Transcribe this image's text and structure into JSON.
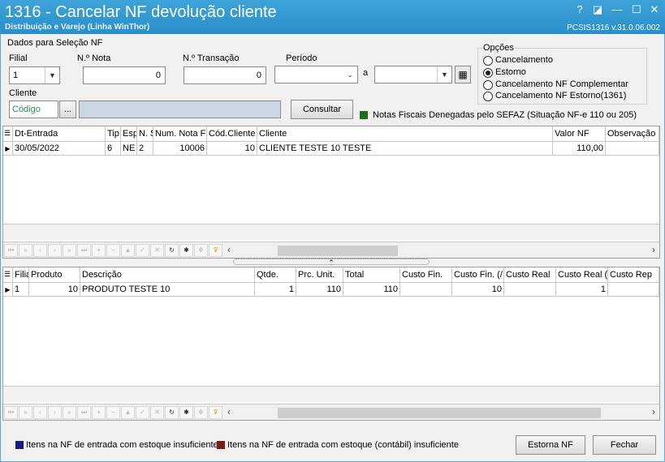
{
  "window": {
    "title": "1316 - Cancelar NF devolução cliente",
    "subtitle": "Distribuição e Varejo (Linha WinThor)",
    "version": "PCSIS1316  v.31.0.06.002",
    "help_glyph": "?",
    "minimize_glyph": "—",
    "maximize_glyph": "☐",
    "close_glyph": "✕",
    "restore_glyph": "◪"
  },
  "filter": {
    "group_label": "Dados para Seleção NF",
    "filial_label": "Filial",
    "filial_value": "1",
    "nota_label": "N.º Nota",
    "nota_value": "0",
    "transacao_label": "N.º Transação",
    "transacao_value": "0",
    "periodo_label": "Período",
    "periodo_sep": "a",
    "periodo_from": "",
    "periodo_to": "",
    "cliente_label": "Cliente",
    "cliente_code": "Código",
    "cliente_dots": "...",
    "cliente_name": "",
    "consultar_label": "Consultar",
    "sefaz_legend": "Notas Fiscais Denegadas pelo SEFAZ (Situação NF-e 110 ou 205)",
    "sefaz_color": "#1e6e1e"
  },
  "opcoes": {
    "label": "Opções",
    "items": [
      {
        "label": "Cancelamento",
        "selected": false
      },
      {
        "label": "Estorno",
        "selected": true
      },
      {
        "label": "Cancelamento NF Complementar",
        "selected": false
      },
      {
        "label": "Cancelamento NF Estorno(1361)",
        "selected": false
      }
    ]
  },
  "grid1": {
    "columns": [
      "Dt-Entrada",
      "Tip",
      "Esp",
      "N. S",
      "Num. Nota F",
      "Cód.Cliente",
      "Cliente",
      "Valor NF",
      "Observação"
    ],
    "rows": [
      {
        "dt": "30/05/2022",
        "tip": "6",
        "esp": "NE",
        "ns": "2",
        "num": "10006",
        "cod": "10",
        "cliente": "CLIENTE TESTE 10 TESTE",
        "valor": "110,00",
        "obs": ""
      }
    ]
  },
  "grid2": {
    "columns": [
      "Filia",
      "Produto",
      "Descrição",
      "Qtde.",
      "Prc. Unit.",
      "Total",
      "Custo Fin.",
      "Custo Fin. (/",
      "Custo Real",
      "Custo Real (",
      "Custo Rep"
    ],
    "rows": [
      {
        "filial": "1",
        "produto": "10",
        "descricao": "PRODUTO TESTE 10",
        "qtde": "1",
        "prc": "110",
        "total": "110",
        "custo_fin": "",
        "custo_fin2": "10",
        "custo_real": "",
        "custo_real2": "1",
        "custo_rep": ""
      }
    ]
  },
  "legend": {
    "item1": "Itens na NF de entrada com estoque insuficiente",
    "item1_color": "#1a1a7a",
    "item2": "Itens na NF de entrada com estoque (contábil) insuficiente",
    "item2_color": "#7a1a1a"
  },
  "buttons": {
    "estorna": "Estorna NF",
    "fechar": "Fechar"
  },
  "nav_glyphs": {
    "first": "⏮",
    "prev_page": "«",
    "prev": "‹",
    "next": "›",
    "next_page": "»",
    "last": "⏭",
    "insert": "+",
    "delete": "−",
    "up": "▲",
    "post": "✓",
    "cancel": "✕",
    "refresh": "↻",
    "star": "✱",
    "star2": "✲",
    "filter": "⊽",
    "scroll_left": "‹",
    "scroll_right": "›",
    "splitter": "⌃",
    "row_indicator": "▶",
    "grid_menu": "☰"
  }
}
